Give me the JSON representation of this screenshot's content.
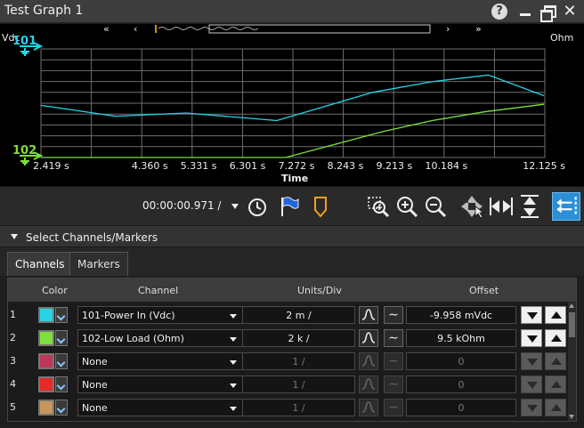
{
  "window": {
    "title": "Test Graph 1",
    "help": "?"
  },
  "graph": {
    "left_unit": "Vdc",
    "right_unit": "Ohm",
    "xlabel": "Time",
    "channel_markers": [
      {
        "id": "101",
        "color": "#27d3e6"
      },
      {
        "id": "102",
        "color": "#7ee03a"
      }
    ],
    "time_ticks": [
      "2.419 s",
      "4.360 s",
      "5.331 s",
      "6.301 s",
      "7.272 s",
      "8.243 s",
      "9.213 s",
      "10.184 s",
      "12.125 s"
    ]
  },
  "chart_data": {
    "type": "line",
    "xlabel": "Time",
    "x_ticks": [
      "2.419 s",
      "4.360 s",
      "5.331 s",
      "6.301 s",
      "7.272 s",
      "8.243 s",
      "9.213 s",
      "10.184 s",
      "12.125 s"
    ],
    "grid": true,
    "series": [
      {
        "name": "101-Power In (Vdc)",
        "color": "#27d3e6",
        "x": [
          2.419,
          3.9,
          5.3,
          7.1,
          9.0,
          10.2,
          11.3,
          12.4
        ],
        "y": [
          0.48,
          0.38,
          0.41,
          0.34,
          0.6,
          0.7,
          0.76,
          0.57
        ]
      },
      {
        "name": "102-Low Load (Ohm)",
        "color": "#7ee03a",
        "x": [
          2.419,
          4.36,
          6.301,
          7.272,
          8.243,
          9.213,
          10.184,
          11.2,
          12.4
        ],
        "y": [
          0.0,
          0.0,
          0.0,
          0.0,
          0.12,
          0.24,
          0.34,
          0.42,
          0.49
        ]
      }
    ]
  },
  "toolbar": {
    "time_readout": "00:00:00.971 /",
    "tools": [
      "clock-icon",
      "flag-icon",
      "marker-icon",
      "zoom-region-icon",
      "zoom-in-icon",
      "zoom-out-icon",
      "pan-icon",
      "fit-horizontal-icon",
      "fit-vertical-icon",
      "scroll-track-icon"
    ]
  },
  "select_panel": {
    "label": "Select Channels/Markers"
  },
  "tabs": [
    {
      "label": "Channels"
    },
    {
      "label": "Markers"
    }
  ],
  "table": {
    "headers": {
      "color": "Color",
      "channel": "Channel",
      "units": "Units/Div",
      "offset": "Offset"
    },
    "rows": [
      {
        "num": "1",
        "color": "#27d3e6",
        "channel": "101-Power In (Vdc)",
        "units": "2 m /",
        "offset": "-9.958 mVdc",
        "enabled": true
      },
      {
        "num": "2",
        "color": "#7ee03a",
        "channel": "102-Low Load (Ohm)",
        "units": "2 k /",
        "offset": "9.5 kOhm",
        "enabled": true
      },
      {
        "num": "3",
        "color": "#c0365a",
        "channel": "None",
        "units": "1 /",
        "offset": "0",
        "enabled": false
      },
      {
        "num": "4",
        "color": "#e62a2a",
        "channel": "None",
        "units": "1 /",
        "offset": "0",
        "enabled": false
      },
      {
        "num": "5",
        "color": "#c9965e",
        "channel": "None",
        "units": "1 /",
        "offset": "0",
        "enabled": false
      }
    ]
  }
}
